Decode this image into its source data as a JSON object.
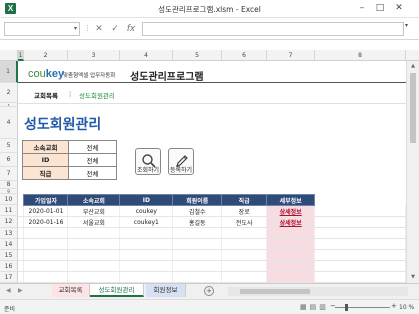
{
  "window": {
    "title": "성도관리프로그램.xlsm - Excel"
  },
  "formula_bar": {
    "cell_ref": "",
    "formula": ""
  },
  "columns": [
    "1",
    "2",
    "3",
    "4",
    "5",
    "6",
    "7",
    "8"
  ],
  "rows": [
    "1",
    "2",
    "3",
    "4",
    "5",
    "6",
    "7",
    "8",
    "9",
    "10",
    "11",
    "12",
    "13",
    "14",
    "15",
    "16",
    "17",
    "18"
  ],
  "header": {
    "logo_prefix": "cou",
    "logo_suffix": "key",
    "logo_subtitle": "맞춤형엑셀 업무자동화",
    "app_title": "성도관리프로그램"
  },
  "nav": {
    "item1": "교회목록",
    "separator": "|",
    "item2": "성도회원관리"
  },
  "page_heading": "성도회원관리",
  "filters": [
    {
      "label": "소속교회",
      "value": "전체"
    },
    {
      "label": "ID",
      "value": "전체"
    },
    {
      "label": "직급",
      "value": "전체"
    }
  ],
  "buttons": {
    "search": "조회하기",
    "register": "등록하기"
  },
  "table": {
    "headers": [
      "가입일자",
      "소속교회",
      "ID",
      "회원이름",
      "직급",
      "세부정보"
    ],
    "rows": [
      [
        "2020-01-01",
        "부산교회",
        "coukey",
        "김철수",
        "장로",
        "상세정보"
      ],
      [
        "2020-01-16",
        "서울교회",
        "coukey1",
        "홍길동",
        "전도사",
        "상세정보"
      ]
    ]
  },
  "sheet_tabs": [
    "교회목록",
    "성도회원관리",
    "회원정보"
  ],
  "status": {
    "ready": "준비",
    "zoom": "10 %"
  }
}
